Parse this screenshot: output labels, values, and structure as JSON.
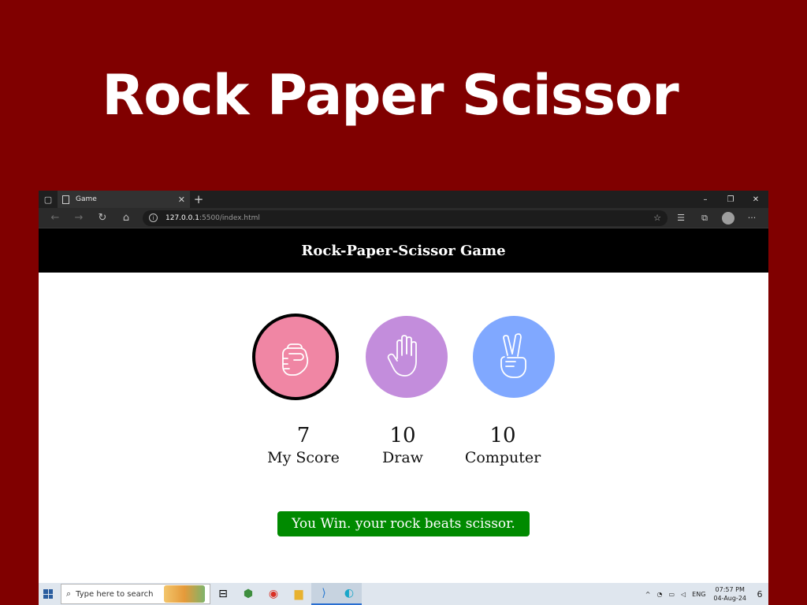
{
  "banner": {
    "title": "Rock Paper Scissor"
  },
  "browser": {
    "tab_title": "Game",
    "url_host": "127.0.0.1",
    "url_path": ":5500/index.html",
    "window_controls": [
      "–",
      "❐",
      "✕"
    ]
  },
  "page": {
    "header": "Rock-Paper-Scissor Game",
    "choices": [
      {
        "id": "rock",
        "color": "#f086a4",
        "selected": true
      },
      {
        "id": "paper",
        "color": "#c38ddc",
        "selected": false
      },
      {
        "id": "scissor",
        "color": "#80a8ff",
        "selected": false
      }
    ],
    "scores": {
      "my_score": "7",
      "my_score_label": "My Score",
      "draw": "10",
      "draw_label": "Draw",
      "computer": "10",
      "computer_label": "Computer"
    },
    "message": "You Win. your rock beats scissor.",
    "message_color": "#008a00"
  },
  "taskbar": {
    "search_placeholder": "Type here to search",
    "language": "ENG",
    "time": "07:57 PM",
    "date": "04-Aug-24",
    "notification_count": "6"
  }
}
